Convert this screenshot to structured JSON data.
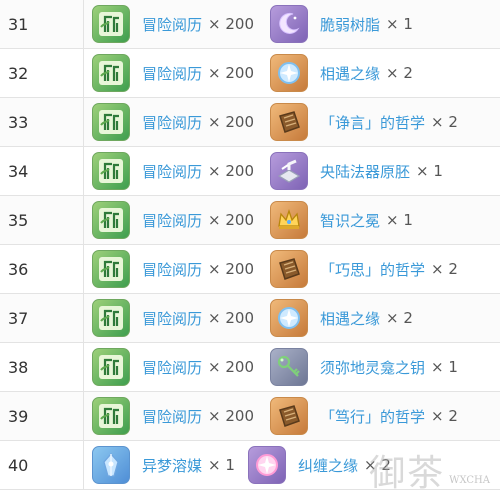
{
  "rows": [
    {
      "index": "31",
      "reward1": {
        "name": "冒险阅历",
        "qty": "× 200",
        "icon": "adventure-exp-icon"
      },
      "reward2": {
        "name": "脆弱树脂",
        "qty": "× 1",
        "icon": "fragile-resin-icon"
      }
    },
    {
      "index": "32",
      "reward1": {
        "name": "冒险阅历",
        "qty": "× 200",
        "icon": "adventure-exp-icon"
      },
      "reward2": {
        "name": "相遇之缘",
        "qty": "× 2",
        "icon": "acquaint-fate-icon"
      }
    },
    {
      "index": "33",
      "reward1": {
        "name": "冒险阅历",
        "qty": "× 200",
        "icon": "adventure-exp-icon"
      },
      "reward2": {
        "name": "「诤言」的哲学",
        "qty": "× 2",
        "icon": "philosophy-book-icon"
      }
    },
    {
      "index": "34",
      "reward1": {
        "name": "冒险阅历",
        "qty": "× 200",
        "icon": "adventure-exp-icon"
      },
      "reward2": {
        "name": "央陆法器原胚",
        "qty": "× 1",
        "icon": "catalyst-billet-icon"
      }
    },
    {
      "index": "35",
      "reward1": {
        "name": "冒险阅历",
        "qty": "× 200",
        "icon": "adventure-exp-icon"
      },
      "reward2": {
        "name": "智识之冕",
        "qty": "× 1",
        "icon": "crown-icon"
      }
    },
    {
      "index": "36",
      "reward1": {
        "name": "冒险阅历",
        "qty": "× 200",
        "icon": "adventure-exp-icon"
      },
      "reward2": {
        "name": "「巧思」的哲学",
        "qty": "× 2",
        "icon": "philosophy-book-icon"
      }
    },
    {
      "index": "37",
      "reward1": {
        "name": "冒险阅历",
        "qty": "× 200",
        "icon": "adventure-exp-icon"
      },
      "reward2": {
        "name": "相遇之缘",
        "qty": "× 2",
        "icon": "acquaint-fate-icon"
      }
    },
    {
      "index": "38",
      "reward1": {
        "name": "冒险阅历",
        "qty": "× 200",
        "icon": "adventure-exp-icon"
      },
      "reward2": {
        "name": "须弥地灵龛之钥",
        "qty": "× 1",
        "icon": "shrine-key-icon"
      }
    },
    {
      "index": "39",
      "reward1": {
        "name": "冒险阅历",
        "qty": "× 200",
        "icon": "adventure-exp-icon"
      },
      "reward2": {
        "name": "「笃行」的哲学",
        "qty": "× 2",
        "icon": "philosophy-book-icon"
      }
    },
    {
      "index": "40",
      "reward1": {
        "name": "异梦溶媒",
        "qty": "× 1",
        "icon": "dream-solvent-icon"
      },
      "reward2": {
        "name": "纠缠之缘",
        "qty": "× 2",
        "icon": "intertwined-fate-icon"
      }
    }
  ],
  "watermark": {
    "text": "御茶",
    "sub": "WXCHA"
  }
}
